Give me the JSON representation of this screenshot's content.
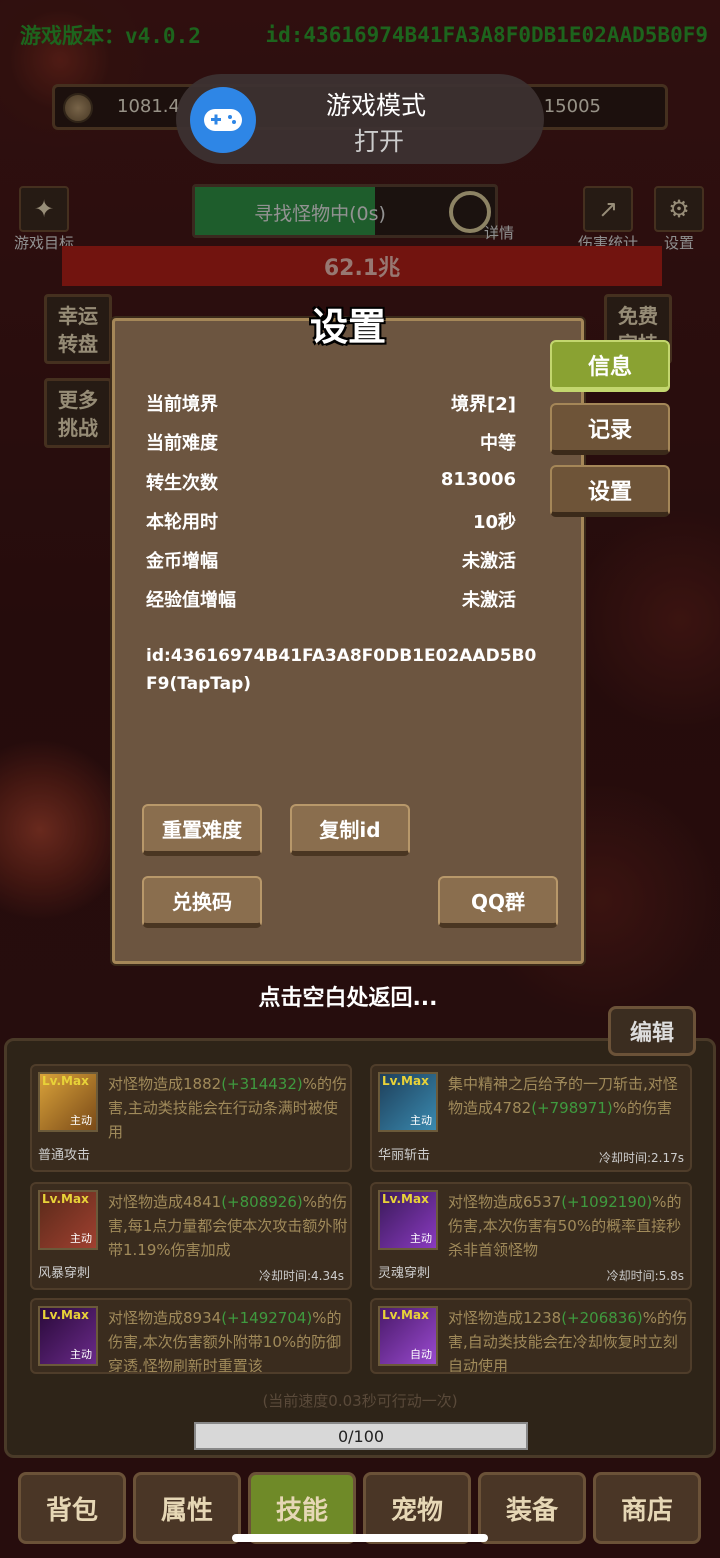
{
  "header": {
    "version": "游戏版本：v4.0.2",
    "id": "id:43616974B41FA3A8F0DB1E02AAD5B0F9"
  },
  "currency": {
    "coins": "1081.4",
    "gems": "15005"
  },
  "toast": {
    "title": "游戏模式",
    "subtitle": "打开"
  },
  "top_buttons": {
    "game_goal": "游戏目标",
    "details": "详情",
    "damage_stats": "伤害统计",
    "settings": "设置"
  },
  "search": {
    "label": "寻找怪物中(0s)",
    "progress": 0.6
  },
  "hp": {
    "value": "62.1兆"
  },
  "features": [
    "幸运\n转盘",
    "更多\n挑战",
    "免费\n宣持"
  ],
  "dialog": {
    "title": "设置",
    "rows": [
      {
        "label": "当前境界",
        "value": "境界[2]"
      },
      {
        "label": "当前难度",
        "value": "中等"
      },
      {
        "label": "转生次数",
        "value": "813006"
      },
      {
        "label": "本轮用时",
        "value": "10秒"
      },
      {
        "label": "金币增幅",
        "value": "未激活"
      },
      {
        "label": "经验值增幅",
        "value": "未激活"
      }
    ],
    "id_text": "id:43616974B41FA3A8F0DB1E02AAD5B0F9(TapTap)",
    "buttons": {
      "reset": "重置难度",
      "copy_id": "复制id",
      "redeem": "兑换码",
      "qq": "QQ群"
    },
    "tabs": {
      "info": "信息",
      "record": "记录",
      "settings": "设置"
    }
  },
  "return_hint": "点击空白处返回...",
  "edit_label": "编辑",
  "skills": [
    {
      "lv": "Lv.Max",
      "type": "主动",
      "name": "普通攻击",
      "desc_a": "对怪物造成1882",
      "desc_hl": "(+314432)",
      "desc_b": "%的伤害,主动类技能会在行动条满时被使用",
      "cd": ""
    },
    {
      "lv": "Lv.Max",
      "type": "主动",
      "name": "华丽斩击",
      "desc_a": "集中精神之后给予的一刀斩击,对怪物造成4782",
      "desc_hl": "(+798971)",
      "desc_b": "%的伤害",
      "cd": "冷却时间:2.17s"
    },
    {
      "lv": "Lv.Max",
      "type": "主动",
      "name": "风暴穿刺",
      "desc_a": "对怪物造成4841",
      "desc_hl": "(+808926)",
      "desc_b": "%的伤害,每1点力量都会使本次攻击额外附带1.19%伤害加成",
      "cd": "冷却时间:4.34s"
    },
    {
      "lv": "Lv.Max",
      "type": "主动",
      "name": "灵魂穿刺",
      "desc_a": "对怪物造成6537",
      "desc_hl": "(+1092190)",
      "desc_b": "%的伤害,本次伤害有50%的概率直接秒杀非首领怪物",
      "cd": "冷却时间:5.8s"
    },
    {
      "lv": "Lv.Max",
      "type": "主动",
      "name": "",
      "desc_a": "对怪物造成8934",
      "desc_hl": "(+1492704)",
      "desc_b": "%的伤害,本次伤害额外附带10%的防御穿透,怪物刷新时重置该",
      "cd": ""
    },
    {
      "lv": "Lv.Max",
      "type": "自动",
      "name": "",
      "desc_a": "对怪物造成1238",
      "desc_hl": "(+206836)",
      "desc_b": "%的伤害,自动类技能会在冷却恢复时立刻自动使用",
      "cd": ""
    }
  ],
  "speed_text": "(当前速度0.03秒可行动一次)",
  "xp": "0/100",
  "nav": [
    "背包",
    "属性",
    "技能",
    "宠物",
    "装备",
    "商店"
  ],
  "colors": {
    "accent_green": "#8aa232",
    "hp_red": "#b02018",
    "toast_blue": "#2e86e6"
  }
}
